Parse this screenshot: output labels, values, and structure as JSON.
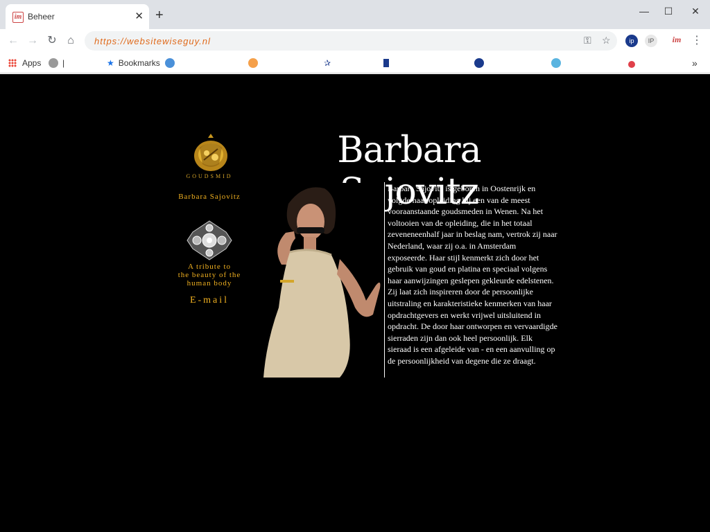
{
  "browser": {
    "tab_title": "Beheer",
    "tab_favicon_text": "im",
    "url": "https://websitewiseguy.nl",
    "bookmarks": [
      {
        "label": "Apps"
      },
      {
        "label": "|"
      },
      {
        "label": "Bookmarks"
      }
    ],
    "more_bookmarks": "»"
  },
  "page": {
    "logo_caption": "GOUDSMID",
    "name_small": "Barbara  Sajovitz",
    "tribute_line1": "A tribute to",
    "tribute_line2": "the beauty of the",
    "tribute_line3": "human body",
    "email_link": "E-mail",
    "title": "Barbara Sajovitz",
    "bio": "Barbara Sajovitz is geboren in Oostenrijk en volgde haar opleiding bij een van de meest vooraanstaande goudsmeden in Wenen. Na het voltooien van de opleiding, die in het totaal zeveneneenhalf jaar in beslag nam, vertrok zij naar Nederland, waar zij o.a. in Amsterdam exposeerde. Haar stijl kenmerkt zich door het gebruik van goud en platina en speciaal volgens haar aanwijzingen geslepen gekleurde edelstenen. Zij laat zich inspireren door de persoonlijke uitstraling en karakteristieke kenmerken van haar opdrachtgevers en werkt vrijwel uitsluitend in opdracht. De door haar ontworpen en vervaardigde sierraden zijn dan ook heel persoonlijk. Elk sieraad is een afgeleide van - en een aanvulling op de persoonlijkheid van degene die ze draagt."
  },
  "colors": {
    "gold": "#f0b020",
    "background": "#000000",
    "text": "#ffffff",
    "url": "#e06a1b"
  }
}
